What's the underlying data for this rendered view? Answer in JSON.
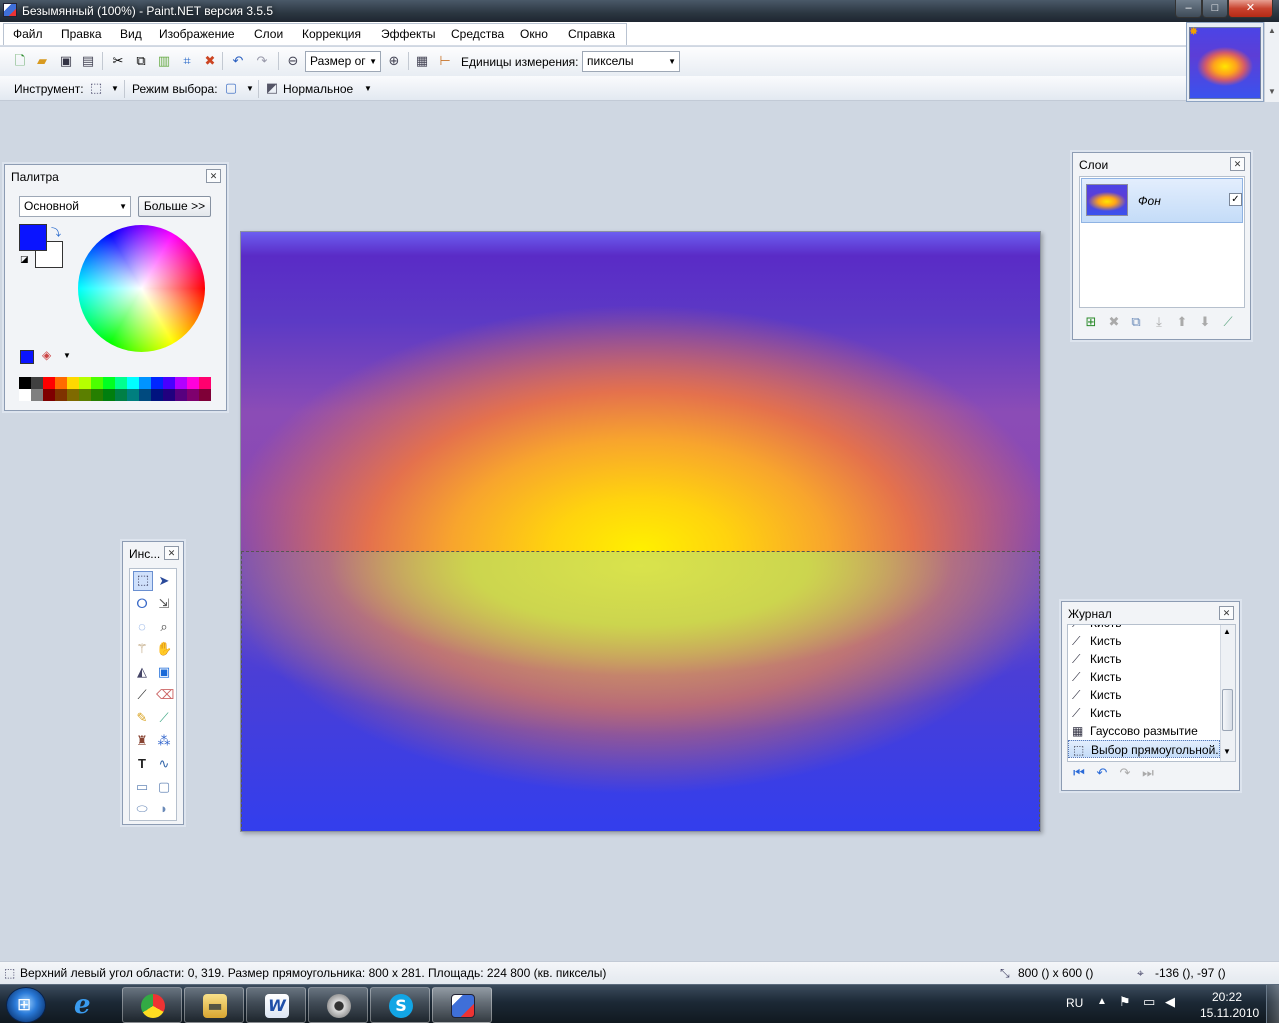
{
  "window": {
    "title": "Безымянный (100%) - Paint.NET версия 3.5.5",
    "min": "–",
    "max": "□",
    "close": "✕"
  },
  "menu": [
    "Файл",
    "Правка",
    "Вид",
    "Изображение",
    "Слои",
    "Коррекция",
    "Эффекты",
    "Средства",
    "Окно",
    "Справка"
  ],
  "toolbar": {
    "zoom_combo": "Размер ог",
    "units_label": "Единицы измерения:",
    "units_value": "пикселы",
    "tool_label": "Инструмент:",
    "mode_label": "Режим выбора:",
    "blend_value": "Нормальное"
  },
  "palette": {
    "title": "Палитра",
    "mode": "Основной",
    "more": "Больше >>",
    "primary_color": "#0a14ff",
    "secondary_color": "#ffffff",
    "swatches_top": [
      "#000000",
      "#404040",
      "#ff0000",
      "#ff6a00",
      "#ffd800",
      "#b6ff00",
      "#4cff00",
      "#00ff21",
      "#00ff90",
      "#00ffff",
      "#0094ff",
      "#0026ff",
      "#4800ff",
      "#b200ff",
      "#ff00dc",
      "#ff006e"
    ],
    "swatches_bottom": [
      "#ffffff",
      "#808080",
      "#7f0000",
      "#7f3300",
      "#7f6a00",
      "#5b7f00",
      "#267f00",
      "#007f0e",
      "#007f46",
      "#007f7f",
      "#004a7f",
      "#00137f",
      "#21007f",
      "#57007f",
      "#7f006e",
      "#7f0037"
    ]
  },
  "tools": {
    "title": "Инс..."
  },
  "layers": {
    "title": "Слои",
    "items": [
      {
        "name": "Фон",
        "visible": true
      }
    ]
  },
  "history": {
    "title": "Журнал",
    "items": [
      "Кисть",
      "Кисть",
      "Кисть",
      "Кисть",
      "Кисть",
      "Кисть",
      "Гауссово размытие",
      "Выбор прямоугольной..."
    ]
  },
  "status": {
    "info": "Верхний левый угол области: 0, 319. Размер прямоугольника: 800 x 281. Площадь: 224 800 (кв. пикселы)",
    "size": "800 () x 600 ()",
    "pointer": "-136 (), -97 ()"
  },
  "taskbar": {
    "lang": "RU",
    "time": "20:22",
    "date": "15.11.2010"
  }
}
